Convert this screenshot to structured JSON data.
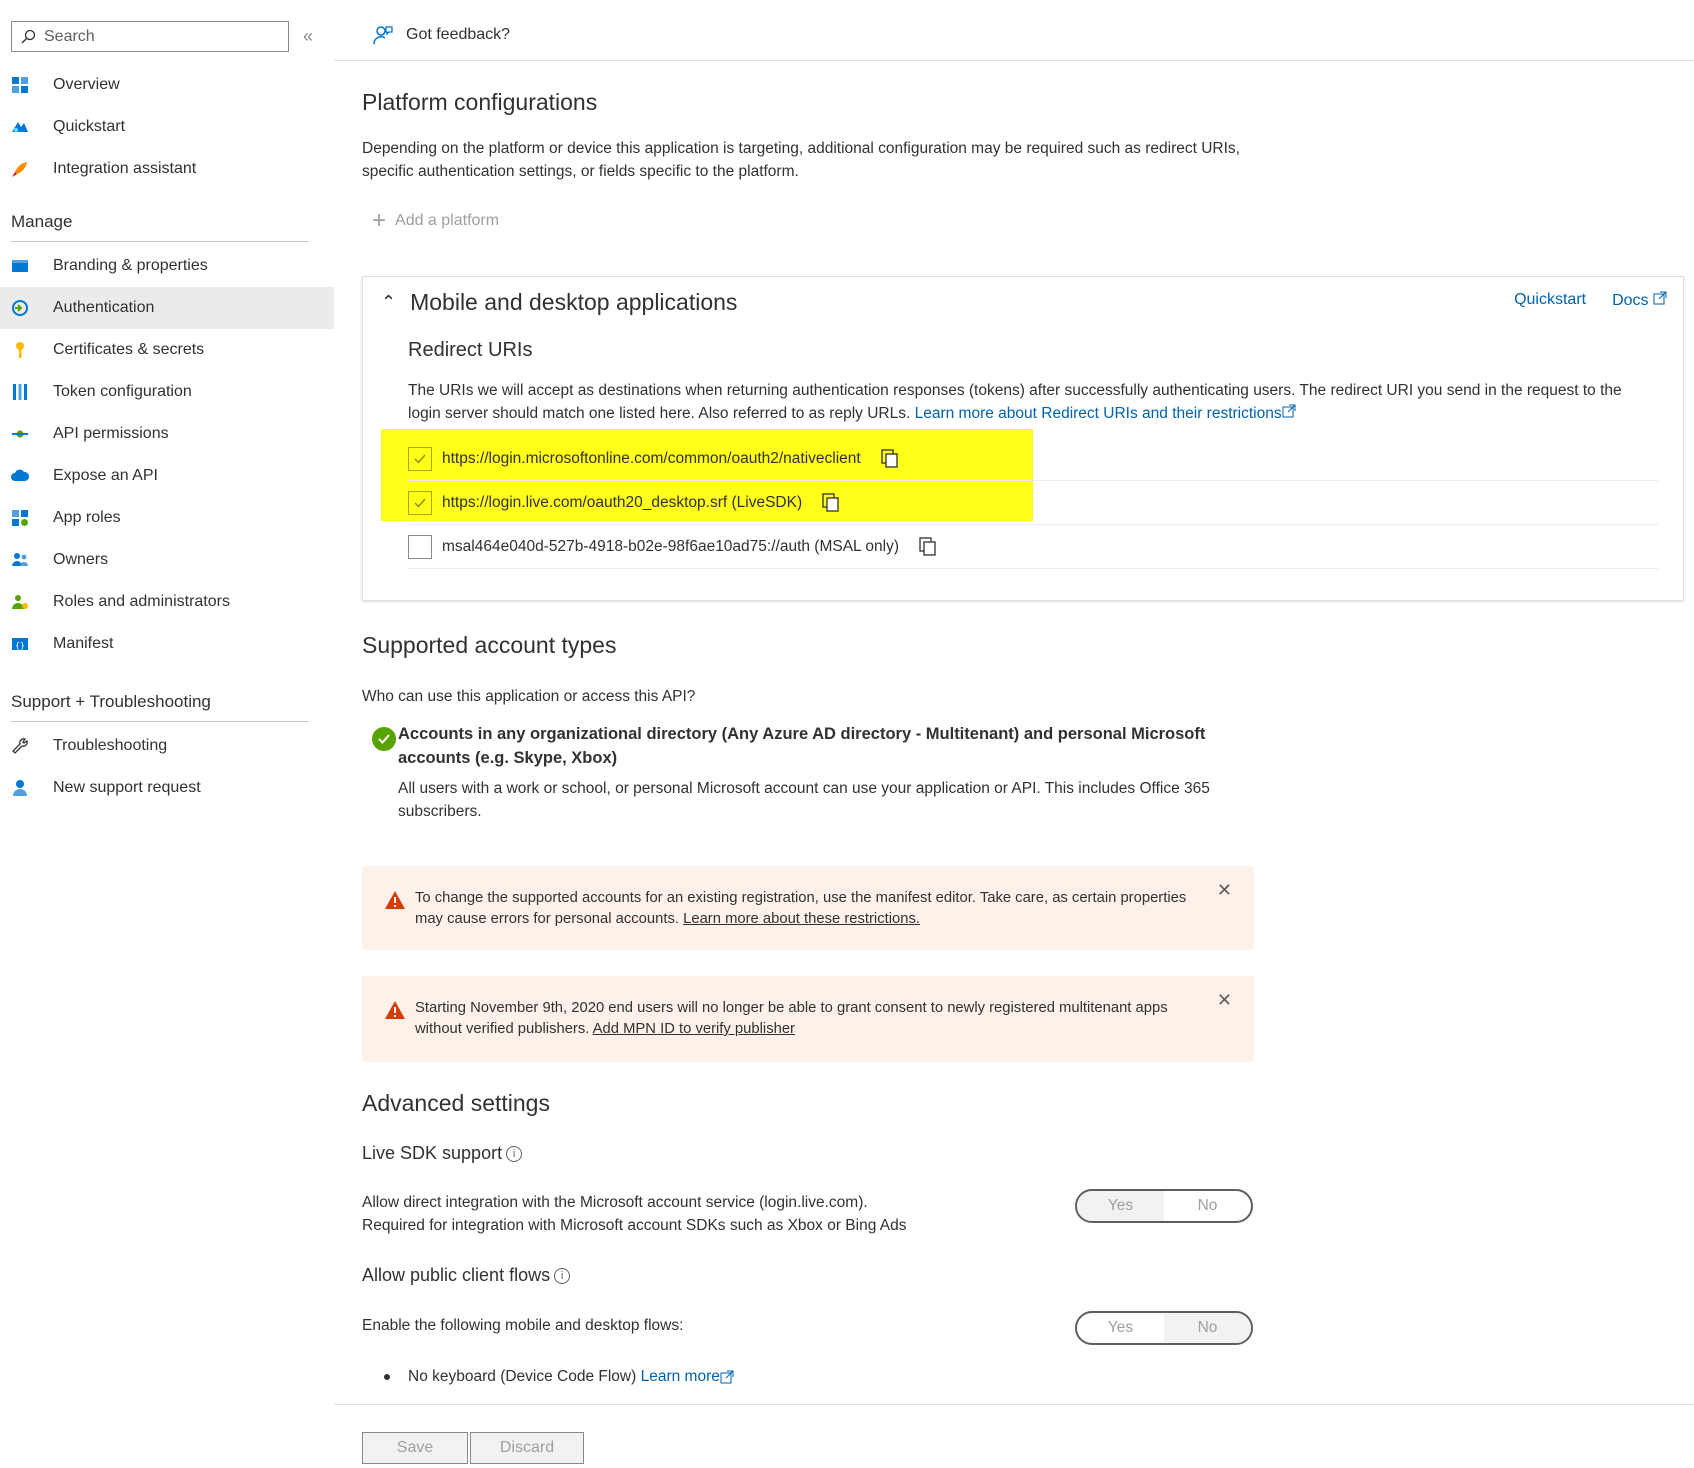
{
  "sidebar": {
    "search_placeholder": "Search",
    "collapse_glyph": "«",
    "top_items": [
      {
        "label": "Overview",
        "icon": "overview-icon"
      },
      {
        "label": "Quickstart",
        "icon": "quickstart-icon"
      },
      {
        "label": "Integration assistant",
        "icon": "rocket-icon"
      }
    ],
    "manage_header": "Manage",
    "manage_items": [
      {
        "label": "Branding & properties",
        "icon": "branding-icon"
      },
      {
        "label": "Authentication",
        "icon": "authentication-icon",
        "active": true
      },
      {
        "label": "Certificates & secrets",
        "icon": "key-icon"
      },
      {
        "label": "Token configuration",
        "icon": "token-icon"
      },
      {
        "label": "API permissions",
        "icon": "api-permissions-icon"
      },
      {
        "label": "Expose an API",
        "icon": "cloud-icon"
      },
      {
        "label": "App roles",
        "icon": "app-roles-icon"
      },
      {
        "label": "Owners",
        "icon": "owners-icon"
      },
      {
        "label": "Roles and administrators",
        "icon": "roles-icon"
      },
      {
        "label": "Manifest",
        "icon": "manifest-icon"
      }
    ],
    "support_header": "Support + Troubleshooting",
    "support_items": [
      {
        "label": "Troubleshooting",
        "icon": "wrench-icon"
      },
      {
        "label": "New support request",
        "icon": "support-person-icon"
      }
    ]
  },
  "topbar": {
    "feedback_label": "Got feedback?"
  },
  "platform": {
    "title": "Platform configurations",
    "description": "Depending on the platform or device this application is targeting, additional configuration may be required such as redirect URIs, specific authentication settings, or fields specific to the platform.",
    "add_platform_label": "Add a platform"
  },
  "mobile_card": {
    "title": "Mobile and desktop applications",
    "quickstart_link": "Quickstart",
    "docs_link": "Docs",
    "redirect_title": "Redirect URIs",
    "redirect_desc": "The URIs we will accept as destinations when returning authentication responses (tokens) after successfully authenticating users. The redirect URI you send in the request to the login server should match one listed here. Also referred to as reply URLs. ",
    "redirect_learn_more": "Learn more about Redirect URIs and their restrictions",
    "uris": [
      {
        "value": "https://login.microsoftonline.com/common/oauth2/nativeclient",
        "checked": true
      },
      {
        "value": "https://login.live.com/oauth20_desktop.srf (LiveSDK)",
        "checked": true
      },
      {
        "value": "msal464e040d-527b-4918-b02e-98f6ae10ad75://auth (MSAL only)",
        "checked": false
      }
    ],
    "highlight_color": "#ffff1a"
  },
  "accounts": {
    "title": "Supported account types",
    "question": "Who can use this application or access this API?",
    "selected_title": "Accounts in any organizational directory (Any Azure AD directory - Multitenant) and personal Microsoft accounts (e.g. Skype, Xbox)",
    "selected_desc": "All users with a work or school, or personal Microsoft account can use your application or API. This includes Office 365 subscribers.",
    "check_color": "#57a300"
  },
  "warnings": [
    {
      "text": "To change the supported accounts for an existing registration, use the manifest editor. Take care, as certain properties may cause errors for personal accounts. ",
      "link": "Learn more about these restrictions."
    },
    {
      "text": "Starting November 9th, 2020 end users will no longer be able to grant consent to newly registered multitenant apps without verified publishers. ",
      "link": "Add MPN ID to verify publisher"
    }
  ],
  "advanced": {
    "title": "Advanced settings",
    "live_sdk_label": "Live SDK support",
    "live_sdk_desc_1": "Allow direct integration with the Microsoft account service (login.live.com).",
    "live_sdk_desc_2": "Required for integration with Microsoft account SDKs such as Xbox or Bing Ads",
    "live_sdk_toggle": {
      "yes": "Yes",
      "no": "No",
      "selected": "Yes"
    },
    "public_client_label": "Allow public client flows",
    "public_client_desc": "Enable the following mobile and desktop flows:",
    "public_client_toggle": {
      "yes": "Yes",
      "no": "No",
      "selected": "No"
    },
    "bullet_text": "No keyboard (Device Code Flow) ",
    "bullet_link": "Learn more"
  },
  "footer": {
    "save_label": "Save",
    "discard_label": "Discard"
  },
  "colors": {
    "link": "#0062ad",
    "warning_bg": "#fdf1ea",
    "warning_icon": "#d83b01",
    "active_nav_bg": "#ebebeb"
  }
}
